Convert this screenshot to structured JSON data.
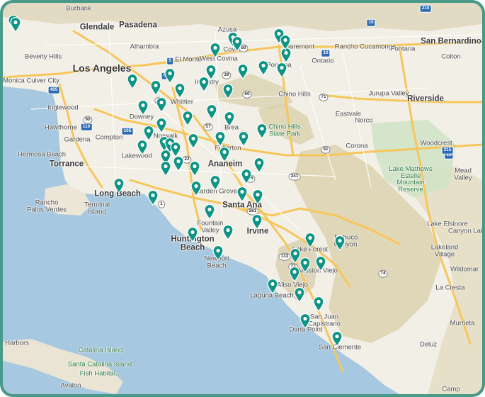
{
  "map": {
    "labels_city_large": [
      "Los Angeles"
    ],
    "labels_city_mid": [
      "Anaheim",
      "Long Beach",
      "Santa Ana",
      "Irvine",
      "Riverside",
      "Torrance",
      "Glendale",
      "Pasadena",
      "Huntington Beach",
      "San Bernardino"
    ],
    "labels_city": [
      "Burbank",
      "Azusa",
      "Claremont",
      "Rancho Cucamonga",
      "Fontana",
      "Alhambra",
      "El Monte",
      "West Covina",
      "Covina",
      "Ontario",
      "Beverly Hills",
      "Pomona",
      "Colton",
      "Monica Culver City",
      "Whittier",
      "Industry",
      "Chino Hills",
      "Jurupa Valley",
      "Inglewood",
      "Downey",
      "Eastvale",
      "Hawthorne",
      "Compton",
      "Norwalk",
      "Brea",
      "Norco",
      "Hermosa Beach",
      "Gardena",
      "Lakewood",
      "Fullerton",
      "Corona",
      "Woodcrest",
      "Mead Valley",
      "Rancho Palos Verdes",
      "Garden Grove",
      "Lake Elsinore",
      "Fountain Valley",
      "Lake Forest",
      "Canyon Lake",
      "Newport Beach",
      "Mission Viejo",
      "Wildomar",
      "Aliso Viejo",
      "Laguna Beach",
      "La Cresta",
      "San Juan Capistrano",
      "Dana Point",
      "San Clemente",
      "Catalina Island",
      "Santa Catalina Island",
      "Fish Habitat...",
      "Avalon",
      "Harbors",
      "Trabuco Canyon",
      "Lakeland Village",
      "Terminal Island",
      "Murrieta",
      "Deluz",
      "Camp"
    ],
    "labels_park": [
      "Chino Hills State Park",
      "Lake Mathews Estelle Mountain Reserve"
    ],
    "shields_interstate": [
      "5",
      "10",
      "15",
      "15",
      "105",
      "110",
      "210",
      "215",
      "405",
      "605"
    ],
    "shields_state": [
      "1",
      "19",
      "22",
      "39",
      "55",
      "57",
      "60",
      "60",
      "71",
      "73",
      "74",
      "90",
      "91",
      "91",
      "133",
      "241",
      "261"
    ],
    "marker_count": 62,
    "colors": {
      "marker": "#0e9485",
      "frame": "#4a9a8a",
      "water": "#a6c8e0",
      "land": "#f2efe6",
      "park": "#cfe3c4",
      "hills": "#ddd3b8",
      "highway": "#f6c65b"
    }
  }
}
